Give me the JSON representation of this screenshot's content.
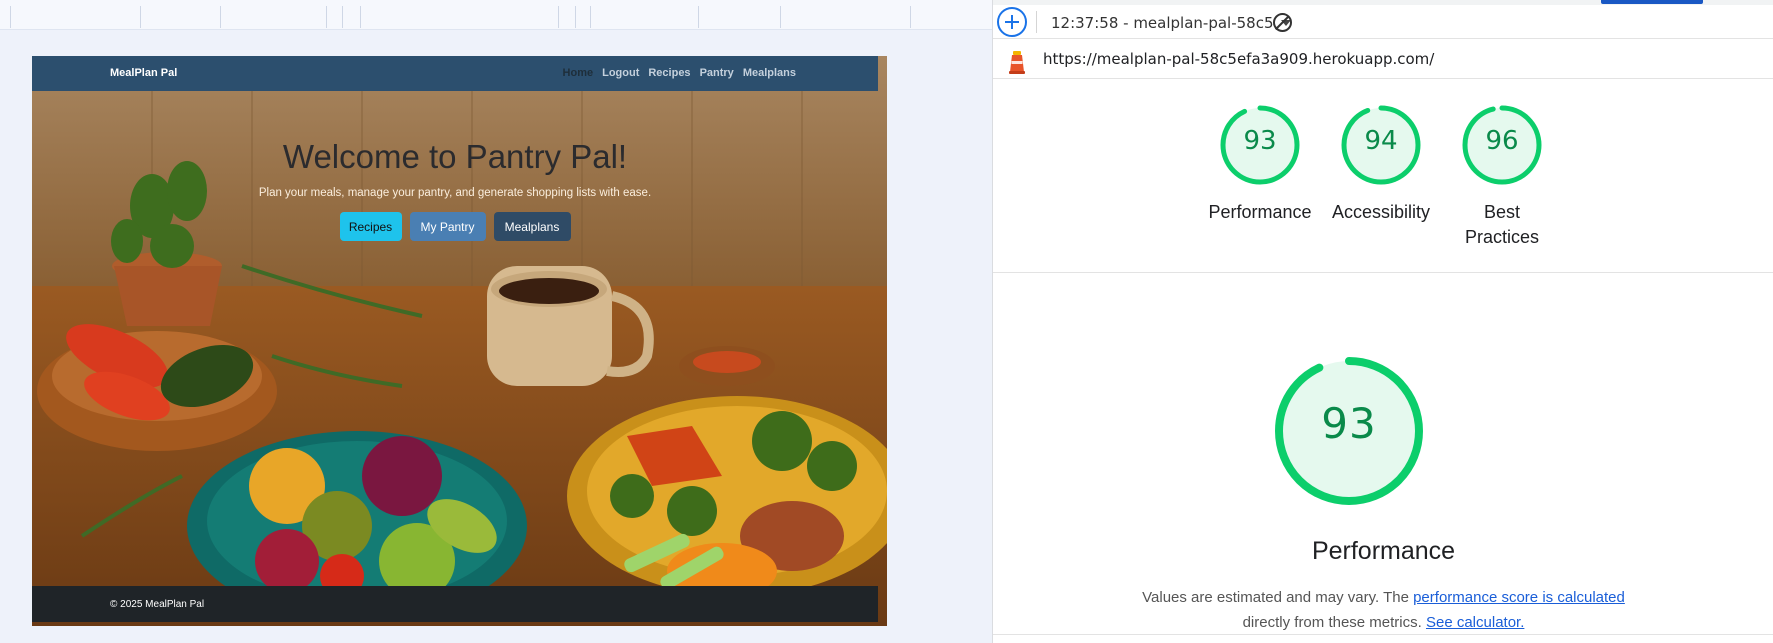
{
  "site": {
    "brand": "MealPlan Pal",
    "nav": [
      "Home",
      "Logout",
      "Recipes",
      "Pantry",
      "Mealplans"
    ],
    "hero_title": "Welcome to Pantry Pal!",
    "hero_subtitle": "Plan your meals, manage your pantry, and generate shopping lists with ease.",
    "buttons": {
      "recipes": "Recipes",
      "pantry": "My Pantry",
      "mealplans": "Mealplans"
    },
    "footer": "© 2025 MealPlan Pal"
  },
  "lighthouse": {
    "report_label": "12:37:58 - mealplan-pal-58c5",
    "url": "https://mealplan-pal-58c5efa3a909.herokuapp.com/",
    "categories": [
      {
        "score": 93,
        "label_lines": [
          "Performance"
        ]
      },
      {
        "score": 94,
        "label_lines": [
          "Accessibility"
        ]
      },
      {
        "score": 96,
        "label_lines": [
          "Best",
          "Practices"
        ]
      }
    ],
    "main": {
      "score": 93,
      "label": "Performance",
      "desc_pre": "Values are estimated and may vary. The ",
      "desc_link1": "performance score is calculated",
      "desc_mid": "directly from these metrics.",
      "desc_link2": "See calculator."
    },
    "colors": {
      "pass": "#0cce6b",
      "pass_fill": "#e5f9ee",
      "score_text": "#0a8a4a"
    }
  }
}
